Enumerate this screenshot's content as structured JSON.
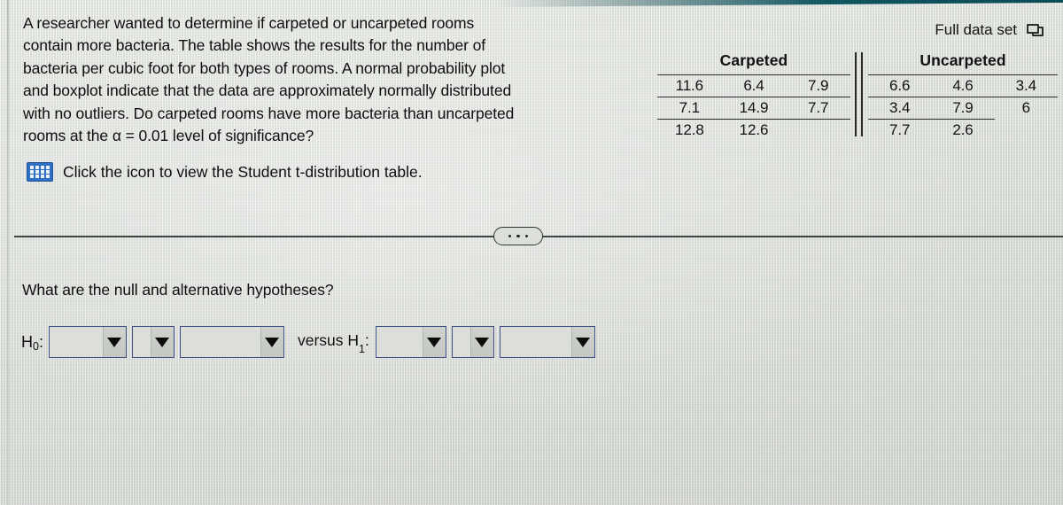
{
  "problem": {
    "lines": [
      "A researcher wanted to determine if carpeted or uncarpeted rooms",
      "contain more bacteria. The table shows the results for the number of",
      "bacteria per cubic foot for both types of rooms. A normal probability plot",
      "and boxplot indicate that the data are approximately normally distributed",
      "with no outliers. Do carpeted rooms have more bacteria than uncarpeted",
      "rooms at the α = 0.01 level of significance?"
    ],
    "icon_link_text": "Click the icon to view the Student t-distribution table.",
    "icon_name": "table-grid-icon"
  },
  "full_data_set": {
    "label": "Full data set",
    "icon_name": "popout-window-icon"
  },
  "table": {
    "groups": [
      {
        "header": "Carpeted",
        "rows": [
          [
            "11.6",
            "6.4",
            "7.9"
          ],
          [
            "7.1",
            "14.9",
            "7.7"
          ],
          [
            "12.8",
            "12.6",
            ""
          ]
        ]
      },
      {
        "header": "Uncarpeted",
        "rows": [
          [
            "6.6",
            "4.6",
            "3.4"
          ],
          [
            "3.4",
            "7.9",
            "6"
          ],
          [
            "7.7",
            "2.6",
            ""
          ]
        ]
      }
    ]
  },
  "separator": {
    "ellipsis": "•••"
  },
  "hypotheses": {
    "question": "What are the null and alternative hypotheses?",
    "null_label": "H",
    "null_sub": "0",
    "null_colon": ":",
    "versus_text": "versus H",
    "alt_sub": "1",
    "alt_colon": ":",
    "null_dropdowns": [
      {
        "value": "",
        "arrow": "▼"
      },
      {
        "value": "",
        "arrow": "▼"
      },
      {
        "value": "",
        "arrow": "▼"
      }
    ],
    "alt_dropdowns": [
      {
        "value": "",
        "arrow": "▼"
      },
      {
        "value": "",
        "arrow": "▼"
      },
      {
        "value": "",
        "arrow": "▼"
      }
    ]
  },
  "colors": {
    "background": "#dcdfd9",
    "text": "#101010",
    "icon_blue": "#2e6fc4",
    "combo_border": "#3f4f84",
    "rule": "#2a2a2a",
    "bezel_teal": "#0f5560"
  }
}
